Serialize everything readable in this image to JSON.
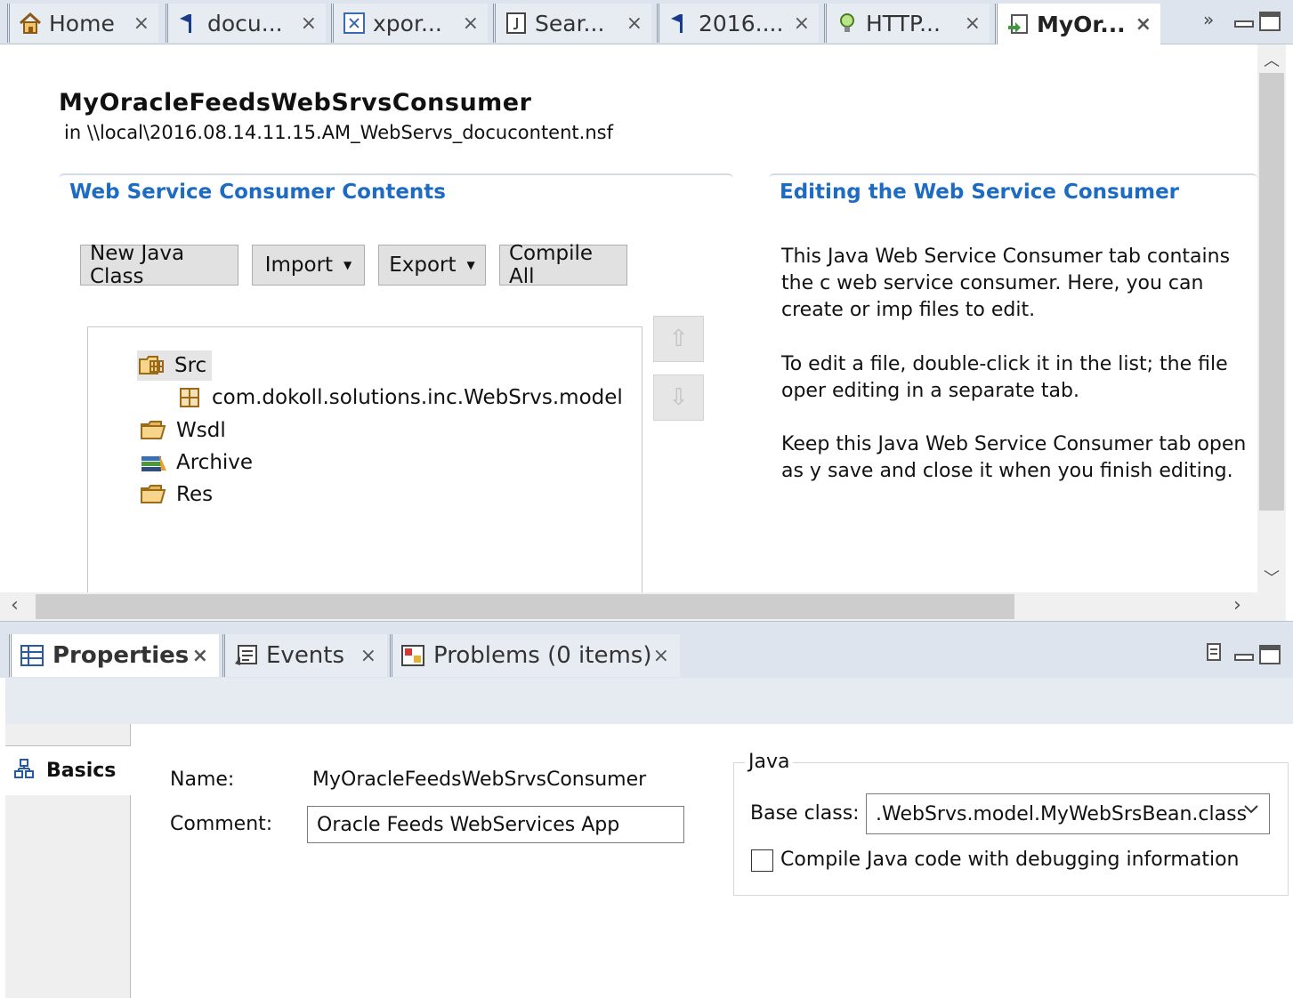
{
  "editor_tabs": [
    {
      "label": "Home",
      "icon": "home-icon"
    },
    {
      "label": "docu...",
      "icon": "flag-icon"
    },
    {
      "label": "xpor...",
      "icon": "xpages-icon"
    },
    {
      "label": "Sear...",
      "icon": "java-file-icon"
    },
    {
      "label": "2016....",
      "icon": "flag-icon"
    },
    {
      "label": "HTTP...",
      "icon": "bulb-icon"
    },
    {
      "label": "MyOr...",
      "icon": "web-service-icon"
    }
  ],
  "tab_close_glyph": "×",
  "editor": {
    "title": "MyOracleFeedsWebSrvsConsumer",
    "location": "in \\\\local\\2016.08.14.11.15.AM_WebServs_docucontent.nsf",
    "contents_heading": "Web Service Consumer Contents",
    "editing_heading": "Editing the Web Service Consumer",
    "buttons": {
      "new_java_class": "New Java Class",
      "import": "Import",
      "export": "Export",
      "compile_all": "Compile All"
    },
    "tree": {
      "src": "Src",
      "package": "com.dokoll.solutions.inc.WebSrvs.model",
      "wsdl": "Wsdl",
      "archive": "Archive",
      "res": "Res"
    },
    "help": [
      "This Java Web Service Consumer tab contains the c web service consumer. Here, you can create or imp files to edit.",
      "To edit a file, double-click it in the list; the file oper editing in a separate tab.",
      "Keep this Java Web Service Consumer tab open as y save and close it when you finish editing."
    ]
  },
  "view_tabs": [
    {
      "label": "Properties",
      "icon": "properties-icon"
    },
    {
      "label": "Events",
      "icon": "events-icon"
    },
    {
      "label": "Problems (0 items)",
      "icon": "problems-icon"
    }
  ],
  "properties": {
    "nav_basics": "Basics",
    "name_label": "Name:",
    "name_value": "MyOracleFeedsWebSrvsConsumer",
    "comment_label": "Comment:",
    "comment_value": "Oracle Feeds WebServices App",
    "java_group": "Java",
    "base_class_label": "Base class:",
    "base_class_value": ".WebSrvs.model.MyWebSrsBean.class",
    "debug_checkbox_label": "Compile Java code with debugging information",
    "debug_checked": false
  },
  "colors": {
    "heading_blue": "#1e6bc4",
    "tabbar_bg": "#dde4ee"
  }
}
